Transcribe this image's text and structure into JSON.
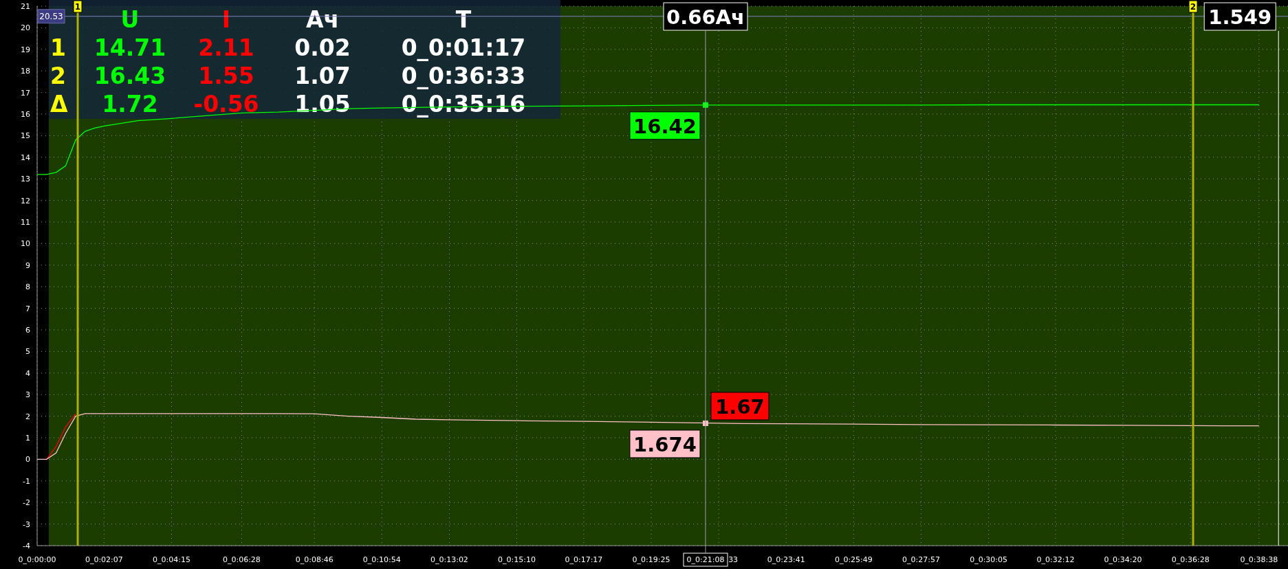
{
  "readout_table": {
    "columns": [
      {
        "label": "U",
        "color": "#00ff00"
      },
      {
        "label": "I",
        "color": "#ff0000"
      },
      {
        "label": "Ач",
        "color": "#ffffff"
      },
      {
        "label": "T",
        "color": "#ffffff"
      }
    ],
    "rows": [
      {
        "label": "1",
        "cells": [
          "14.71",
          "2.11",
          "0.02",
          "0_0:01:17"
        ]
      },
      {
        "label": "2",
        "cells": [
          "16.43",
          "1.55",
          "1.07",
          "0_0:36:33"
        ]
      },
      {
        "label": "Δ",
        "cells": [
          "1.72",
          "-0.56",
          "1.05",
          "0_0:35:16"
        ]
      }
    ]
  },
  "chart_data": {
    "type": "line",
    "categories": [
      "0_0:00:00",
      null,
      null,
      null,
      null,
      null,
      null,
      "0_0:02:07",
      null,
      "0_0:04:15",
      "0_0:06:28",
      null,
      "0_0:08:46",
      null,
      "0_0:10:54",
      null,
      "0_0:13:02",
      "0_0:15:10",
      "0_0:17:17",
      "0_0:19:25",
      null,
      null,
      "0_0:23:41",
      "0_0:25:49",
      "0_0:27:57",
      "0_0:30:05",
      "0_0:32:12",
      "0_0:34:20",
      "0_0:36:28",
      "0_0:38:38"
    ],
    "series": [
      {
        "color": "#00ff00",
        "values": [
          13.2,
          13.2,
          13.3,
          13.6,
          14.8,
          15.2,
          15.35,
          15.45,
          15.69,
          15.8,
          16.05,
          16.09,
          16.17,
          16.25,
          16.28,
          16.31,
          16.33,
          16.36,
          16.38,
          16.4,
          16.42,
          16.42,
          16.42,
          16.42,
          16.42,
          16.43,
          16.43,
          16.43,
          16.43,
          16.43
        ]
      },
      {
        "color": "#ff0000",
        "values": [
          null,
          0,
          0.6,
          1.5,
          2.11,
          null,
          null,
          null,
          null,
          null,
          null,
          null,
          null,
          null,
          null,
          null,
          null,
          null,
          null,
          null,
          null,
          null,
          null,
          null,
          null,
          null,
          null,
          null,
          null,
          null
        ]
      },
      {
        "color": "#ffc0c8",
        "values": [
          0,
          0,
          0.3,
          1.2,
          2.0,
          2.12,
          2.12,
          2.12,
          2.12,
          2.12,
          2.12,
          2.12,
          2.11,
          2.0,
          1.94,
          1.86,
          1.83,
          1.79,
          1.76,
          1.72,
          1.69,
          1.66,
          1.65,
          1.63,
          1.61,
          1.6,
          1.59,
          1.58,
          1.56,
          1.55
        ]
      }
    ],
    "grid": true,
    "ref_lines": [
      {
        "axis": "y",
        "value": 20.53,
        "label": "20.53"
      }
    ],
    "ylim": [
      -4,
      21
    ],
    "yticks": [
      -4,
      -3,
      -2,
      -1,
      0,
      1,
      2,
      3,
      4,
      5,
      6,
      7,
      8,
      9,
      10,
      11,
      12,
      13,
      14,
      15,
      16,
      17,
      18,
      19,
      20,
      21
    ]
  },
  "overlays": [
    {
      "kind": "marker",
      "text": "1"
    },
    {
      "kind": "marker",
      "text": "2"
    },
    {
      "kind": "cursor",
      "text": "0.66Ач"
    },
    {
      "kind": "point",
      "text": "16.42",
      "color": "#00ff00"
    },
    {
      "kind": "point",
      "text": "1.67",
      "color": "#ff0000"
    },
    {
      "kind": "point",
      "text": "1.674",
      "color": "#ffc0c8"
    },
    {
      "kind": "xlabel",
      "text": "0_0:21:08"
    },
    {
      "kind": "tick_tail",
      "text": "33"
    },
    {
      "kind": "vline",
      "text": "1.549"
    }
  ]
}
